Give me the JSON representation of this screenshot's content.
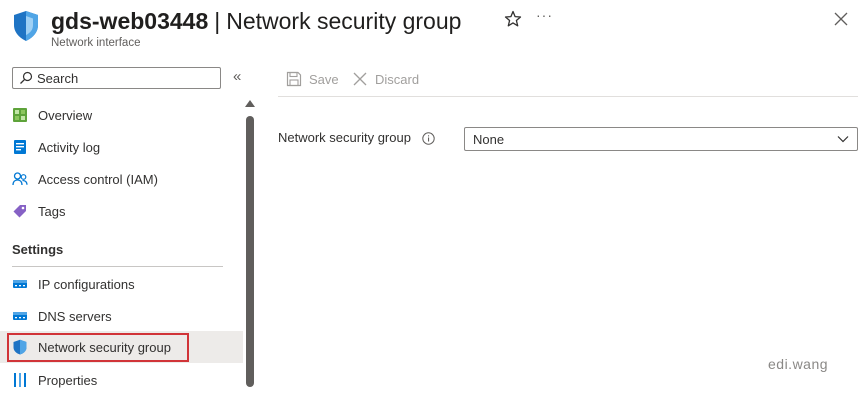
{
  "header": {
    "resource_name": "gds-web03448",
    "separator": "|",
    "page_title": "Network security group",
    "subtitle": "Network interface",
    "more_label": "···"
  },
  "sidebar": {
    "search_placeholder": "Search",
    "collapse_label": "«",
    "items": [
      {
        "label": "Overview",
        "icon": "overview-icon"
      },
      {
        "label": "Activity log",
        "icon": "activity-log-icon"
      },
      {
        "label": "Access control (IAM)",
        "icon": "people-icon"
      },
      {
        "label": "Tags",
        "icon": "tag-icon"
      }
    ],
    "settings_header": "Settings",
    "settings_items": [
      {
        "label": "IP configurations",
        "icon": "ip-config-icon"
      },
      {
        "label": "DNS servers",
        "icon": "dns-icon"
      },
      {
        "label": "Network security group",
        "icon": "shield-icon",
        "selected": true
      },
      {
        "label": "Properties",
        "icon": "properties-icon"
      }
    ]
  },
  "toolbar": {
    "save_label": "Save",
    "discard_label": "Discard"
  },
  "form": {
    "nsg_label": "Network security group",
    "nsg_value": "None"
  },
  "watermark": "edi.wang",
  "colors": {
    "accent": "#0078d4",
    "selected_bg": "#edebe9",
    "highlight_border": "#d13438",
    "disabled_text": "#a19f9d"
  }
}
